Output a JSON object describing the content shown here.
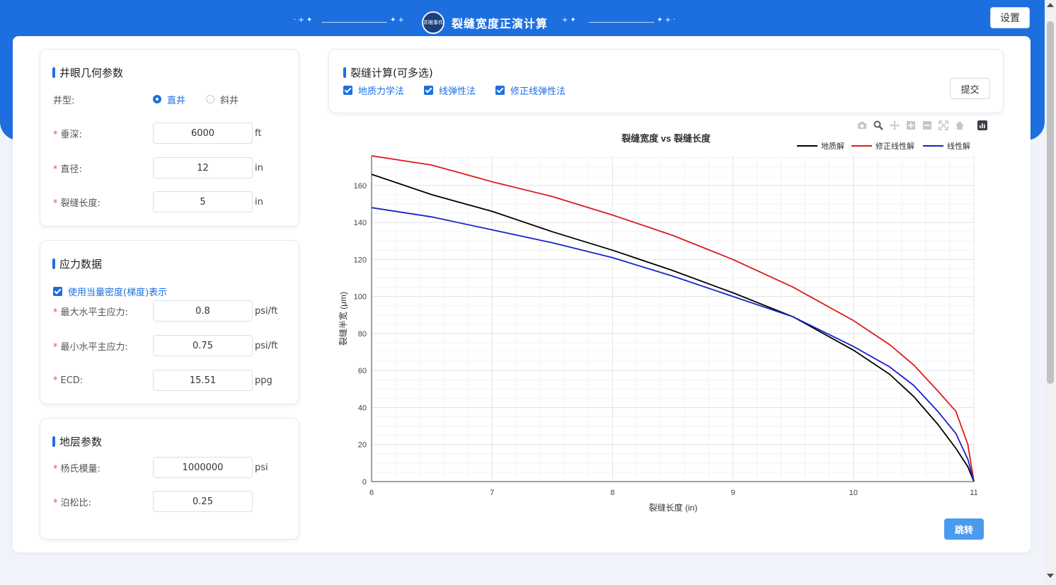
{
  "header": {
    "title": "裂缝宽度正演计算",
    "logo_text": "井眼事件",
    "settings_label": "设置"
  },
  "wellbore": {
    "title": "井眼几何参数",
    "well_type_label": "井型:",
    "well_type_options": [
      "直井",
      "斜井"
    ],
    "well_type_selected": "直井",
    "tvd_label": "垂深:",
    "tvd_value": "6000",
    "tvd_unit": "ft",
    "diameter_label": "直径:",
    "diameter_value": "12",
    "diameter_unit": "in",
    "frac_length_label": "裂缝长度:",
    "frac_length_value": "5",
    "frac_length_unit": "in"
  },
  "stress": {
    "title": "应力数据",
    "equiv_density_label": "使用当量密度(梯度)表示",
    "equiv_density_checked": true,
    "max_h_label": "最大水平主应力:",
    "max_h_value": "0.8",
    "max_h_unit": "psi/ft",
    "min_h_label": "最小水平主应力:",
    "min_h_value": "0.75",
    "min_h_unit": "psi/ft",
    "ecd_label": "ECD:",
    "ecd_value": "15.51",
    "ecd_unit": "ppg"
  },
  "formation": {
    "title": "地层参数",
    "youngs_label": "杨氏模量:",
    "youngs_value": "1000000",
    "youngs_unit": "psi",
    "poisson_label": "泊松比:",
    "poisson_value": "0.25"
  },
  "calc": {
    "title": "裂缝计算(可多选)",
    "methods": [
      "地质力学法",
      "线弹性法",
      "修正线弹性法"
    ],
    "methods_checked": [
      true,
      true,
      true
    ],
    "submit_label": "提交"
  },
  "modebar_icons": [
    "camera-icon",
    "zoom-icon",
    "pan-icon",
    "zoom-in-icon",
    "zoom-out-icon",
    "autoscale-icon",
    "reset-axes-icon",
    "chart-logo-icon"
  ],
  "chart_data": {
    "type": "line",
    "title": "裂缝宽度 vs 裂缝长度",
    "xlabel": "裂缝长度 (in)",
    "ylabel": "裂缝半宽 (μm)",
    "xlim": [
      6,
      11
    ],
    "ylim": [
      0,
      176
    ],
    "xticks": [
      6,
      7,
      8,
      9,
      10,
      11
    ],
    "yticks": [
      0,
      20,
      40,
      60,
      80,
      100,
      120,
      140,
      160
    ],
    "grid": true,
    "legend_position": "top-right",
    "series": [
      {
        "name": "地质解",
        "color": "#000000",
        "x": [
          6,
          6.5,
          7,
          7.5,
          8,
          8.5,
          9,
          9.5,
          10,
          10.3,
          10.5,
          10.7,
          10.85,
          10.95,
          11
        ],
        "y": [
          166,
          155,
          146,
          135,
          125,
          114,
          102,
          89,
          71,
          58,
          46,
          31,
          18,
          8,
          0
        ]
      },
      {
        "name": "修正线性解",
        "color": "#dd1a1a",
        "x": [
          6,
          6.5,
          7,
          7.5,
          8,
          8.5,
          9,
          9.5,
          10,
          10.3,
          10.5,
          10.7,
          10.85,
          10.95,
          11
        ],
        "y": [
          176,
          171,
          162,
          154,
          144,
          133,
          120,
          105,
          87,
          74,
          63,
          49,
          38,
          20,
          0
        ]
      },
      {
        "name": "线性解",
        "color": "#1d22c8",
        "x": [
          6,
          6.5,
          7,
          7.5,
          8,
          8.5,
          9,
          9.5,
          10,
          10.3,
          10.5,
          10.7,
          10.85,
          10.95,
          11
        ],
        "y": [
          148,
          143,
          136,
          129,
          121,
          111,
          100,
          89,
          73,
          62,
          52,
          38,
          26,
          12,
          0
        ]
      }
    ]
  },
  "jump_label": "跳转"
}
